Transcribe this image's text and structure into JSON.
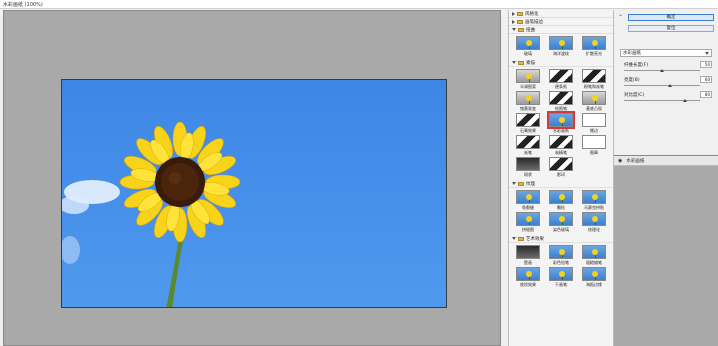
{
  "window": {
    "title": "水彩画纸 (100%)"
  },
  "gallery": {
    "collapsed_top": [
      "风格化",
      "画笔描边"
    ],
    "categories": [
      {
        "name": "扭曲",
        "items": [
          "玻璃",
          "海洋波纹",
          "扩散亮光"
        ],
        "thumbs": [
          "blue",
          "blue",
          "blue"
        ]
      },
      {
        "name": "素描",
        "items": [
          "半调图案",
          "便条纸",
          "粉笔和炭笔",
          "铬黄渐变",
          "绘图笔",
          "基底凸现",
          "石膏效果",
          "水彩画纸",
          "撕边",
          "炭笔",
          "炭精笔",
          "图章",
          "网状",
          "影印"
        ],
        "thumbs": [
          "gray",
          "bw",
          "bw",
          "gray",
          "bw",
          "gray",
          "bw",
          "blue",
          "cut",
          "bw",
          "bw",
          "cut",
          "dark",
          "bw"
        ],
        "selected": "水彩画纸"
      },
      {
        "name": "纹理",
        "items": [
          "龟裂缝",
          "颗粒",
          "马赛克拼贴",
          "拼缀图",
          "染色玻璃",
          "纹理化"
        ],
        "thumbs": [
          "blue",
          "blue",
          "blue",
          "blue",
          "blue",
          "blue"
        ]
      },
      {
        "name": "艺术效果",
        "items": [
          "壁画",
          "彩色铅笔",
          "粗糙蜡笔",
          "底纹效果",
          "干画笔",
          "海报边缘"
        ],
        "thumbs": [
          "dark",
          "blue",
          "blue",
          "blue",
          "blue",
          "blue"
        ]
      }
    ]
  },
  "controls": {
    "ok_label": "确定",
    "cancel_label": "复位",
    "filter_select": "水彩画纸",
    "params": [
      {
        "label": "纤维长度(F)",
        "value": "50",
        "fraction": 0.5
      },
      {
        "label": "亮度(B)",
        "value": "60",
        "fraction": 0.6
      },
      {
        "label": "对比度(C)",
        "value": "80",
        "fraction": 0.8
      }
    ]
  },
  "layers": {
    "items": [
      {
        "name": "水彩画纸"
      }
    ]
  }
}
